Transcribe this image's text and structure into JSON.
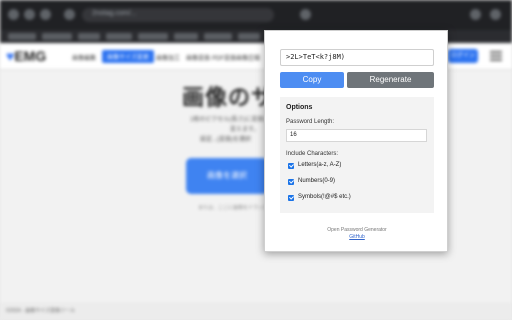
{
  "browser": {
    "url_text": "2notag.com/..."
  },
  "site": {
    "logo_text": "EMG",
    "nav": [
      "画像編集",
      "画像サイズ変更",
      "画像加工",
      "画像変換",
      "PDF変換",
      "画像圧縮"
    ],
    "header_button": "ログイン",
    "hero_title": "画像のサイ",
    "hero_lines": [
      "1枚のピクセル(長さ)に変換して",
      "変えます。",
      "設定...(変換)を選択"
    ],
    "hero_button": "画像を選択",
    "hero_small": "または、ここに画像をドラッグ",
    "footer": "©2024 - 画像サイズ変換ツール"
  },
  "popup": {
    "password": ">2L>TeT<k?j8M)",
    "copy_label": "Copy",
    "regenerate_label": "Regenerate",
    "options_title": "Options",
    "length_label": "Password Length:",
    "length_value": "16",
    "include_label": "Include Characters:",
    "checkboxes": [
      {
        "label": "Letters(a-z, A-Z)",
        "checked": true
      },
      {
        "label": "Numbers(0-9)",
        "checked": true
      },
      {
        "label": "Symbols(!@#$ etc.)",
        "checked": true
      }
    ],
    "credit": "Open Password Generator",
    "credit_link": "GitHub"
  },
  "colors": {
    "accent": "#4d8df2",
    "secondary_button": "#6f757a",
    "checkbox": "#1a73e8"
  }
}
